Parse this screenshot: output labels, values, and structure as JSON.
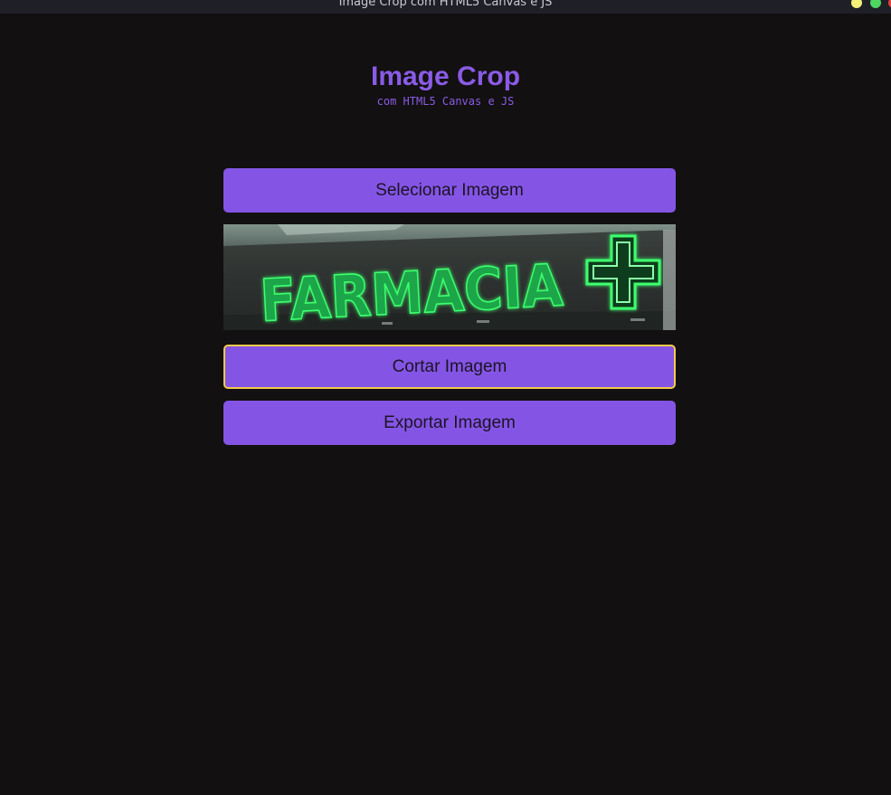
{
  "window": {
    "title": "Image Crop com HTML5 Canvas e JS",
    "controls": [
      "minimize",
      "maximize",
      "close"
    ]
  },
  "header": {
    "title": "Image Crop",
    "subtitle": "com HTML5 Canvas e JS"
  },
  "actions": {
    "select_label": "Selecionar Imagem",
    "crop_label": "Cortar Imagem",
    "export_label": "Exportar Imagem"
  },
  "preview": {
    "sign_text": "FARMACIA"
  },
  "colors": {
    "background": "#121010",
    "accent": "#8455e4",
    "title": "#8a5be6",
    "focus_outline": "#f2c94c",
    "neon_green": "#3dff6e"
  }
}
